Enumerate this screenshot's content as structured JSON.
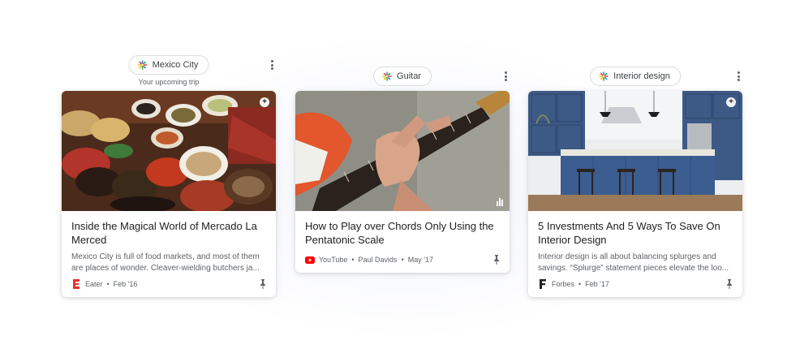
{
  "cards": [
    {
      "topic": "Mexico City",
      "subtitle": "Your upcoming trip",
      "title": "Inside the Magical World of Mercado La Merced",
      "snippet": "Mexico City is full of food markets, and most of them are places of wonder. Cleaver-wielding butchers ja...",
      "source": "Eater",
      "date": "Feb '16",
      "source_icon": "eater-logo-icon"
    },
    {
      "topic": "Guitar",
      "title": "How to Play over Chords Only Using the Pentatonic Scale",
      "source": "YouTube",
      "author": "Paul Davids",
      "date": "May '17",
      "source_icon": "youtube-logo-icon"
    },
    {
      "topic": "Interior design",
      "title": "5 Investments And 5 Ways To Save On Interior Design",
      "snippet": "Interior design is all about balancing splurges and savings. “Splurge” statement pieces elevate the loo...",
      "source": "Forbes",
      "date": "Feb '17",
      "source_icon": "forbes-logo-icon"
    }
  ],
  "separator": "•",
  "colors": {
    "youtube_red": "#ff0000",
    "eater_red": "#e5322d",
    "title_text": "#202124",
    "secondary_text": "#5f6368"
  }
}
